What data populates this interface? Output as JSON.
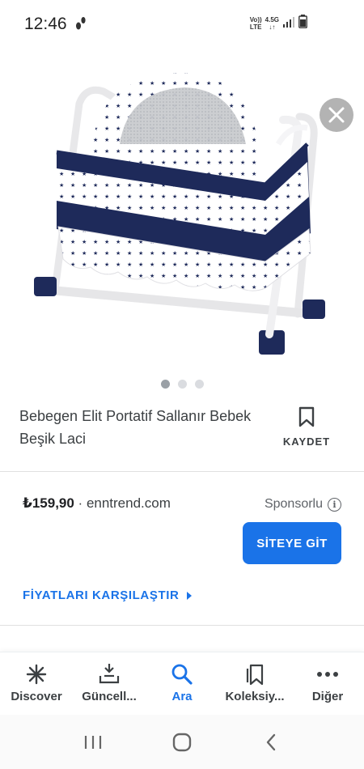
{
  "status_bar": {
    "time": "12:46",
    "volte_line1": "Vo))",
    "volte_line2": "LTE",
    "network_line1": "4.5G",
    "network_line2": "↓↑"
  },
  "product": {
    "title": "Bebegen Elit Portatif Sallanır Bebek Beşik Laci",
    "save_label": "KAYDET",
    "image_count": 3,
    "active_image": 0
  },
  "offer": {
    "price": "₺159,90",
    "separator": " · ",
    "seller": "enntrend.com",
    "sponsored_label": "Sponsorlu",
    "visit_button": "SİTEYE GİT",
    "compare_link": "FİYATLARI KARŞILAŞTIR"
  },
  "bottom_nav": {
    "items": [
      {
        "label": "Discover",
        "icon": "asterisk-icon"
      },
      {
        "label": "Güncell...",
        "icon": "updates-icon"
      },
      {
        "label": "Ara",
        "icon": "search-icon"
      },
      {
        "label": "Koleksiy...",
        "icon": "collections-icon"
      },
      {
        "label": "Diğer",
        "icon": "more-icon"
      }
    ],
    "active_index": 2
  },
  "colors": {
    "accent": "#1a73e8",
    "bassinet_navy": "#1e2a5a",
    "close_button_bg": "#b3b3b3"
  }
}
